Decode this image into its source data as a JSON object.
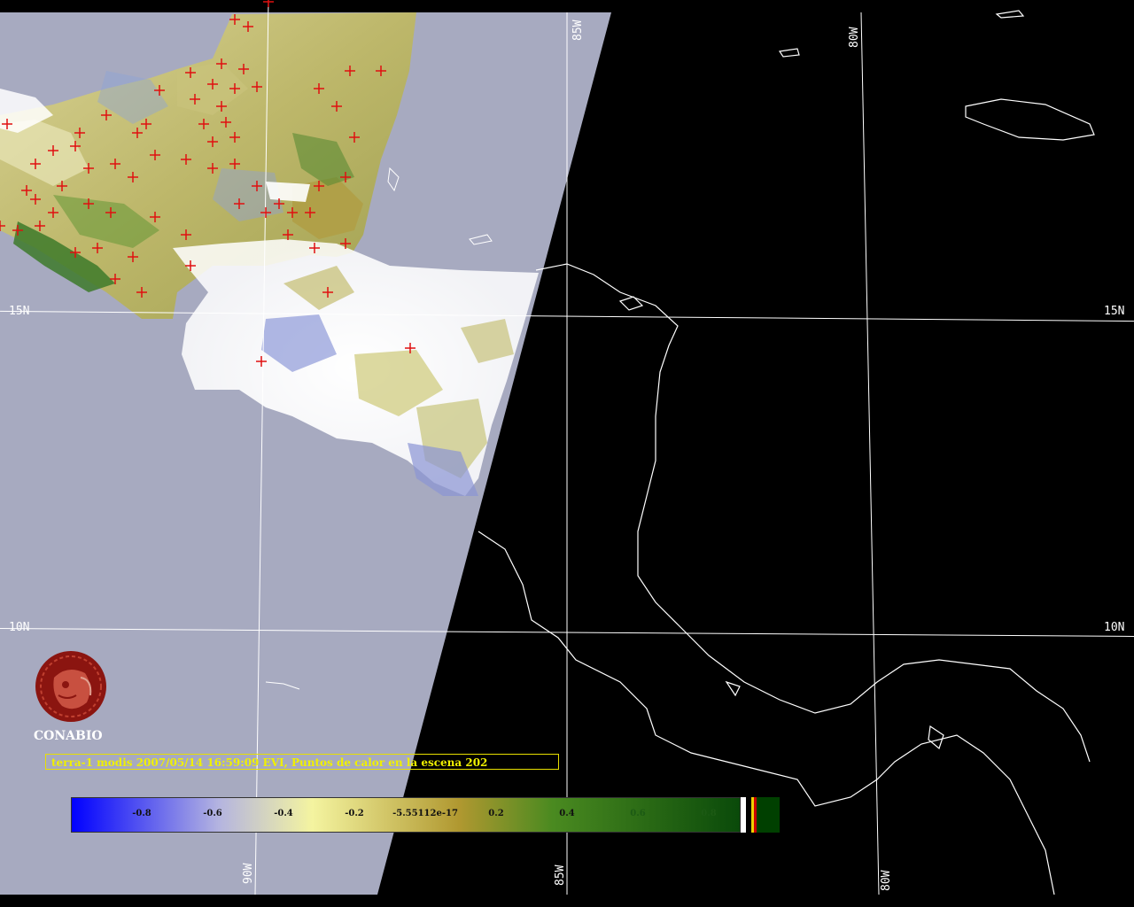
{
  "caption": "terra-1 modis 2007/05/14 16:59:09 EVI, Puntos de calor en la escena 202",
  "logo": {
    "text": "CONABIO",
    "icon": "conabio-logo-icon"
  },
  "grid_labels": {
    "lat_15n": "15N",
    "lat_10n": "10N",
    "lon_85w": "85W",
    "lon_80w": "80W",
    "lon_90w": "90W"
  },
  "colorbar": {
    "ticks": [
      "-0.8",
      "-0.6",
      "-0.4",
      "-0.2",
      "-5.55112e-17",
      "0.2",
      "0.4",
      "0.6",
      "0.8"
    ],
    "colors": {
      "low": "#0000ff",
      "mid_low": "#b4b4e0",
      "neutral": "#f4f4a0",
      "mid_high": "#b09830",
      "high": "#0a4a0a"
    },
    "extra_colors": [
      "#ffffff",
      "#000000",
      "#f0d000",
      "#cc0000",
      "#004000"
    ]
  },
  "colors": {
    "swath_background": "#a7aac0",
    "night_background": "#000000",
    "hotspot": "#e01010",
    "grid_line": "#ffffff",
    "caption_text": "#f0f000"
  }
}
